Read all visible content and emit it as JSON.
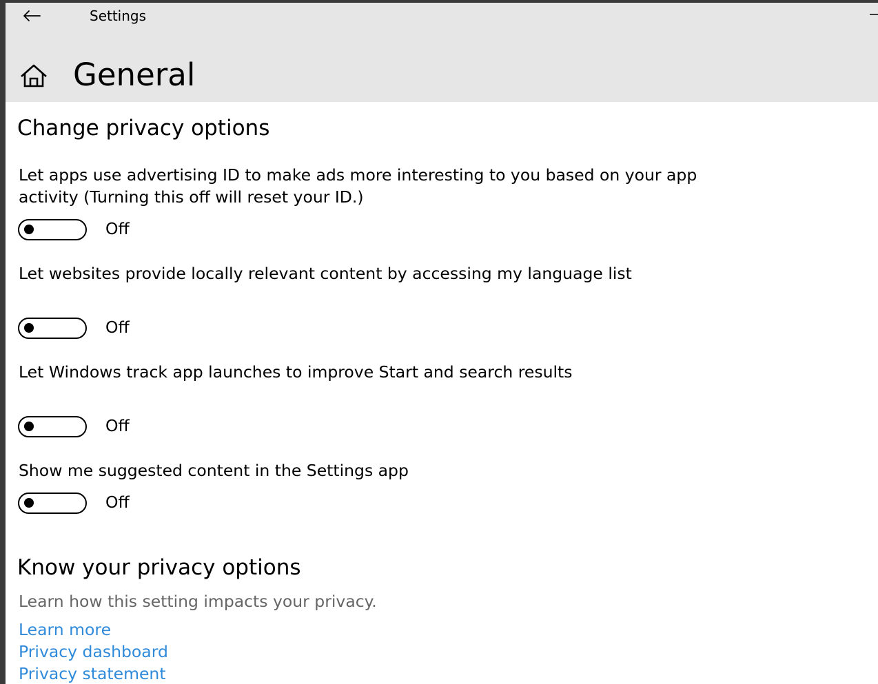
{
  "window": {
    "app_title": "Settings",
    "page_title": "General"
  },
  "change_section": {
    "title": "Change privacy options",
    "settings": [
      {
        "description": "Let apps use advertising ID to make ads more interesting to you based on your app activity (Turning this off will reset your ID.)",
        "state": "Off",
        "enabled": false
      },
      {
        "description": "Let websites provide locally relevant content by accessing my language list",
        "state": "Off",
        "enabled": false
      },
      {
        "description": "Let Windows track app launches to improve Start and search results",
        "state": "Off",
        "enabled": false
      },
      {
        "description": "Show me suggested content in the Settings app",
        "state": "Off",
        "enabled": false
      }
    ]
  },
  "know_section": {
    "title": "Know your privacy options",
    "help_text": "Learn how this setting impacts your privacy.",
    "links": [
      "Learn more",
      "Privacy dashboard",
      "Privacy statement"
    ]
  },
  "colors": {
    "header_bg": "#e6e6e6",
    "link": "#2f8ad9",
    "help_text": "#666666"
  },
  "icons": {
    "back": "arrow-left-icon",
    "home": "home-icon",
    "minimize": "minimize-icon"
  }
}
